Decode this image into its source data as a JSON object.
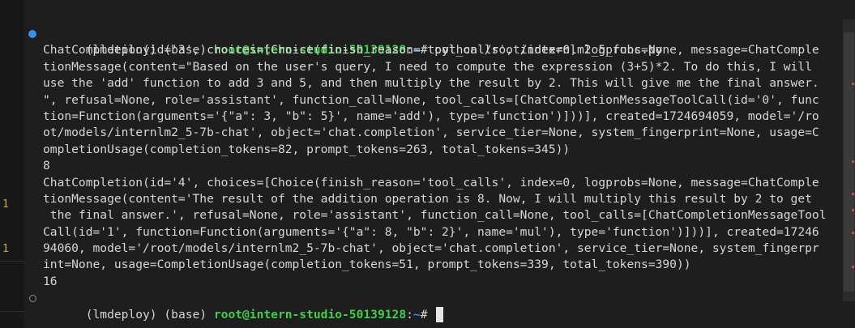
{
  "gutter": {
    "markers": [
      "1",
      "1"
    ]
  },
  "terminal": {
    "prompt1": {
      "env": "(lmdeploy) (base) ",
      "user_host": "root@intern-studio-50139128",
      "sep": ":",
      "path": "~",
      "symbol": "# ",
      "command": "python /root/internlm2_5_func.py"
    },
    "output_lines": [
      "ChatCompletion(id='3', choices=[Choice(finish_reason='tool_calls', index=0, logprobs=None, message=ChatComple",
      "tionMessage(content=\"Based on the user's query, I need to compute the expression (3+5)*2. To do this, I will",
      "use the 'add' function to add 3 and 5, and then multiply the result by 2. This will give me the final answer.",
      "\", refusal=None, role='assistant', function_call=None, tool_calls=[ChatCompletionMessageToolCall(id='0', func",
      "tion=Function(arguments='{\"a\": 3, \"b\": 5}', name='add'), type='function')]))], created=1724694059, model='/ro",
      "ot/models/internlm2_5-7b-chat', object='chat.completion', service_tier=None, system_fingerprint=None, usage=C",
      "ompletionUsage(completion_tokens=82, prompt_tokens=263, total_tokens=345))",
      "8",
      "ChatCompletion(id='4', choices=[Choice(finish_reason='tool_calls', index=0, logprobs=None, message=ChatComple",
      "tionMessage(content='The result of the addition operation is 8. Now, I will multiply this result by 2 to get",
      " the final answer.', refusal=None, role='assistant', function_call=None, tool_calls=[ChatCompletionMessageTool",
      "Call(id='1', function=Function(arguments='{\"a\": 8, \"b\": 2}', name='mul'), type='function')]))], created=17246",
      "94060, model='/root/models/internlm2_5-7b-chat', object='chat.completion', service_tier=None, system_fingerpr",
      "int=None, usage=CompletionUsage(completion_tokens=51, prompt_tokens=339, total_tokens=390))",
      "16"
    ],
    "prompt2": {
      "env": "(lmdeploy) (base) ",
      "user_host": "root@intern-studio-50139128",
      "sep": ":",
      "path": "~",
      "symbol": "# "
    }
  },
  "colors": {
    "background": "#1e1e1e",
    "text": "#d6d6d6",
    "user_host": "#3fcf48",
    "path": "#3b8eea",
    "success_dot": "#3b8eea",
    "gutter_marker": "#c8a84a"
  }
}
